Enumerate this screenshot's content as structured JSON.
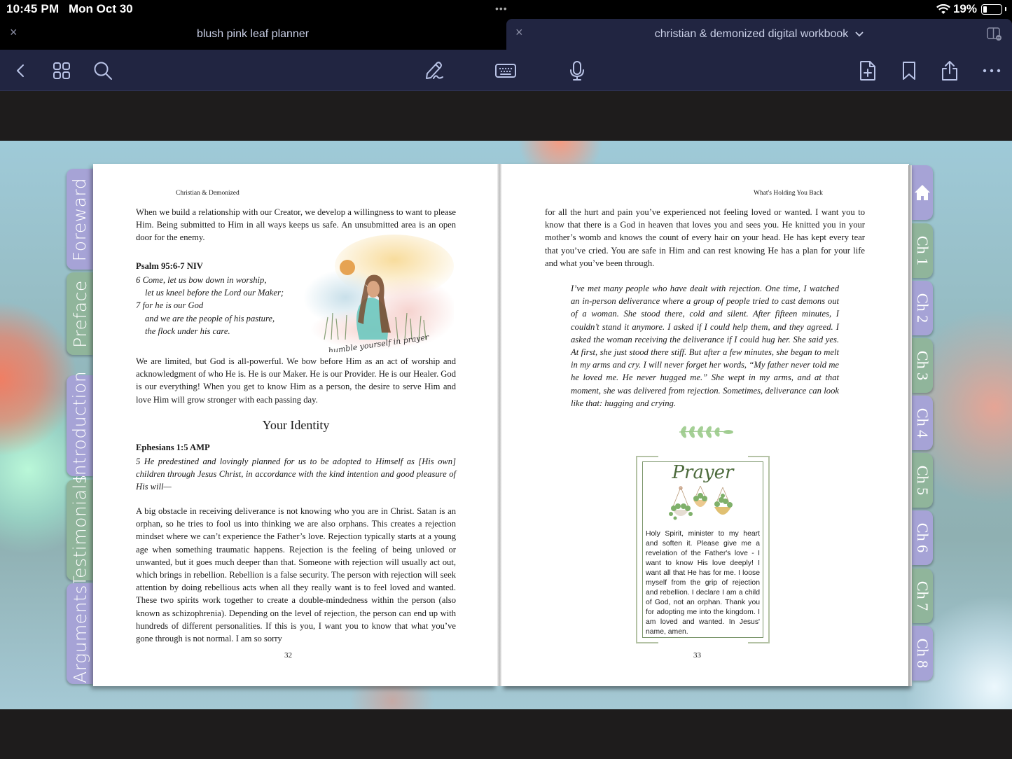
{
  "status_bar": {
    "time": "10:45 PM",
    "date": "Mon Oct 30",
    "dots": "•••",
    "battery_percent": "19%",
    "battery_level": 0.19
  },
  "tabs": [
    {
      "label": "blush pink leaf planner",
      "active": false
    },
    {
      "label": "christian & demonized digital workbook",
      "active": true
    }
  ],
  "toolbar": {
    "icons": [
      "back-icon",
      "grid-icon",
      "search-icon",
      "pen-icon",
      "keyboard-icon",
      "microphone-icon",
      "add-page-icon",
      "bookmark-icon",
      "share-icon",
      "more-icon"
    ]
  },
  "colors": {
    "toolbar_bg": "#212541",
    "tab_purple": "#a6a3d6",
    "tab_green": "#90b59b",
    "prayer_green": "#4d6b3d"
  },
  "left_tabs": [
    {
      "label": "Foreward",
      "color": "purple"
    },
    {
      "label": "Preface",
      "color": "green"
    },
    {
      "label": "Introduction",
      "color": "purple"
    },
    {
      "label": "Testimonials",
      "color": "green"
    },
    {
      "label": "Arguments",
      "color": "purple"
    }
  ],
  "right_tabs": [
    {
      "label": "home",
      "icon": "home-icon",
      "color": "purple"
    },
    {
      "label": "Ch 1",
      "color": "green"
    },
    {
      "label": "Ch 2",
      "color": "purple"
    },
    {
      "label": "Ch 3",
      "color": "green"
    },
    {
      "label": "Ch 4",
      "color": "purple"
    },
    {
      "label": "Ch 5",
      "color": "green"
    },
    {
      "label": "Ch 6",
      "color": "purple"
    },
    {
      "label": "Ch 7",
      "color": "green"
    },
    {
      "label": "Ch 8",
      "color": "purple"
    }
  ],
  "left_page": {
    "running_head": "Christian & Demonized",
    "para1": "When we build a relationship with our Creator, we develop a willingness to want to please Him. Being submitted to Him in all ways keeps us safe. An unsubmitted area is an open door for the enemy.",
    "psalm_ref": "Psalm 95:6-7 NIV",
    "psalm_lines": [
      "6 Come, let us bow down in worship,",
      "let us kneel before the Lord our Maker;",
      "7 for he is our God",
      "and we are the people of his pasture,",
      "the flock under his care."
    ],
    "art_caption": "humble yourself in prayer",
    "para2": "We are limited, but God is all-powerful. We bow before Him as an act of worship and acknowledgment of who He is. He is our Maker. He is our Provider. He is our Healer. God is our everything! When you get to know Him as a person, the desire to serve Him and love Him will grow stronger with each passing day.",
    "section_title": "Your Identity",
    "ephesians_ref": "Ephesians 1:5 AMP",
    "ephesians_text": "5 He predestined and lovingly planned for us to be adopted to Himself as [His own] children through Jesus Christ, in accordance with the kind intention and good pleasure of His will—",
    "para3": "A big obstacle in receiving deliverance is not knowing who you are in Christ. Satan is an orphan, so he tries to fool us into thinking we are also orphans. This creates a rejection mindset where we can’t experience the Father’s love. Rejection typically starts at a young age when something traumatic happens. Rejection is the feeling of being unloved or unwanted, but it goes much deeper than that. Someone with rejection will usually act out, which brings in rebellion. Rebellion is a false security. The person with rejection will seek attention by doing rebellious acts when all they really want is to feel loved and wanted. These two spirits work together to create a double-mindedness within the person (also known as schizophrenia). Depending on the level of rejection, the person can end up with hundreds of different personalities. If this is you, I want you to know that what you’ve gone through is not normal. I am so sorry",
    "page_number": "32"
  },
  "right_page": {
    "running_head": "What's Holding You Back",
    "para1": "for all the hurt and pain you’ve experienced not feeling loved or wanted. I want you to know that there is a God in heaven that loves you and sees you. He knitted you in your mother’s womb and knows the count of every hair on your head. He has kept every tear that you’ve cried. You are safe in Him and can rest knowing He has a plan for your life and what you’ve been through.",
    "story": "I’ve met many people who have dealt with rejection. One time, I watched an in-person deliverance where a group of people tried to cast demons out of a woman. She stood there, cold and silent. After fifteen minutes, I couldn’t stand it anymore. I asked if I could help them, and they agreed. I asked the woman receiving the deliverance if I could hug her. She said yes. At first, she just stood there stiff. But after a few minutes, she began to melt in my arms and cry. I will never forget her words, “My father never told me he loved me. He never hugged me.” She wept in my arms, and at that moment, she was delivered from rejection. Sometimes, deliverance can look like that: hugging and crying.",
    "prayer_title": "Prayer",
    "prayer_text": "Holy Spirit, minister to my heart and soften it. Please give me a revelation of the Father's love - I want to know His love deeply! I want all that He has for me. I loose myself from the grip of rejection and rebellion. I declare I am a child of God, not an orphan. Thank you for adopting me into the kingdom. I am loved and wanted. In Jesus' name, amen.",
    "page_number": "33"
  }
}
